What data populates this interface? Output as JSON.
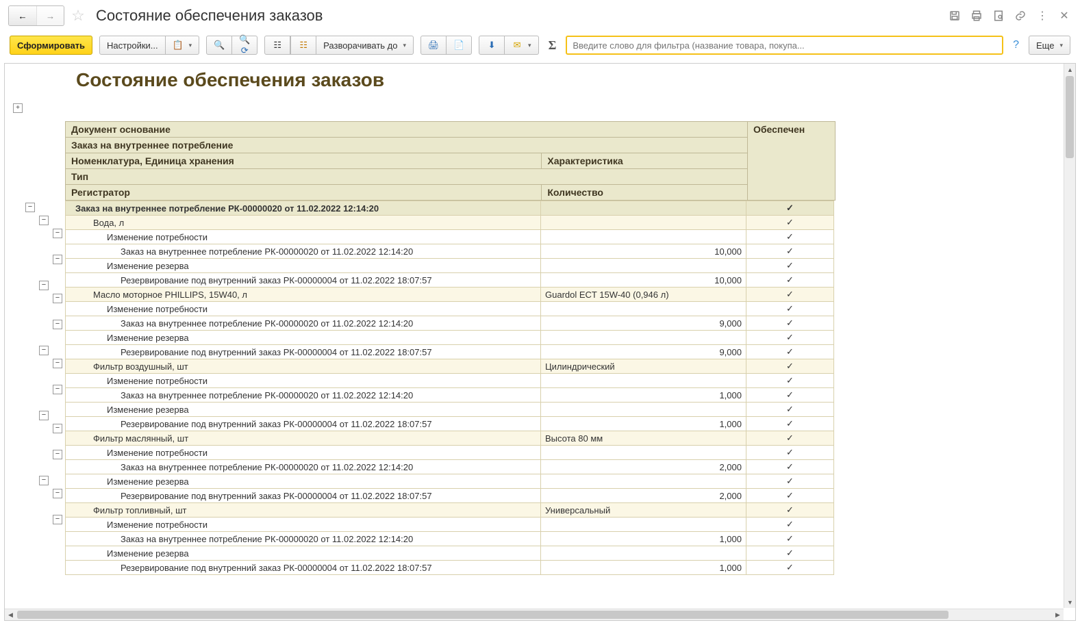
{
  "page_title": "Состояние обеспечения заказов",
  "report_title": "Состояние обеспечения заказов",
  "toolbar": {
    "generate": "Сформировать",
    "settings": "Настройки...",
    "expand_to": "Разворачивать до",
    "filter_placeholder": "Введите слово для фильтра (название товара, покупа...",
    "more": "Еще"
  },
  "headers": {
    "doc_basis": "Документ основание",
    "provided": "Обеспечен",
    "order_internal": "Заказ на внутреннее потребление",
    "nomenclature": "Номенклатура, Единица хранения",
    "characteristic": "Характеристика",
    "type": "Тип",
    "registrar": "Регистратор",
    "quantity": "Количество"
  },
  "rows": [
    {
      "lvl": 0,
      "text": "Заказ на внутреннее потребление РК-00000020 от 11.02.2022 12:14:20",
      "char": "",
      "prov": "✓"
    },
    {
      "lvl": 1,
      "text": "Вода, л",
      "char": "",
      "prov": "✓"
    },
    {
      "lvl": 2,
      "text": "Изменение потребности",
      "prov": "✓"
    },
    {
      "lvl": 3,
      "text": "Заказ на внутреннее потребление РК-00000020 от 11.02.2022 12:14:20",
      "qty": "10,000",
      "prov": "✓"
    },
    {
      "lvl": 2,
      "text": "Изменение резерва",
      "prov": "✓"
    },
    {
      "lvl": 3,
      "text": "Резервирование под внутренний заказ РК-00000004 от 11.02.2022 18:07:57",
      "qty": "10,000",
      "prov": "✓"
    },
    {
      "lvl": 1,
      "text": "Масло моторное PHILLIPS, 15W40, л",
      "char": "Guardol ECT 15W-40 (0,946 л)",
      "prov": "✓"
    },
    {
      "lvl": 2,
      "text": "Изменение потребности",
      "prov": "✓"
    },
    {
      "lvl": 3,
      "text": "Заказ на внутреннее потребление РК-00000020 от 11.02.2022 12:14:20",
      "qty": "9,000",
      "prov": "✓"
    },
    {
      "lvl": 2,
      "text": "Изменение резерва",
      "prov": "✓"
    },
    {
      "lvl": 3,
      "text": "Резервирование под внутренний заказ РК-00000004 от 11.02.2022 18:07:57",
      "qty": "9,000",
      "prov": "✓"
    },
    {
      "lvl": 1,
      "text": "Фильтр воздушный, шт",
      "char": "Цилиндрический",
      "prov": "✓"
    },
    {
      "lvl": 2,
      "text": "Изменение потребности",
      "prov": "✓"
    },
    {
      "lvl": 3,
      "text": "Заказ на внутреннее потребление РК-00000020 от 11.02.2022 12:14:20",
      "qty": "1,000",
      "prov": "✓"
    },
    {
      "lvl": 2,
      "text": "Изменение резерва",
      "prov": "✓"
    },
    {
      "lvl": 3,
      "text": "Резервирование под внутренний заказ РК-00000004 от 11.02.2022 18:07:57",
      "qty": "1,000",
      "prov": "✓"
    },
    {
      "lvl": 1,
      "text": "Фильтр маслянный, шт",
      "char": "Высота 80 мм",
      "prov": "✓"
    },
    {
      "lvl": 2,
      "text": "Изменение потребности",
      "prov": "✓"
    },
    {
      "lvl": 3,
      "text": "Заказ на внутреннее потребление РК-00000020 от 11.02.2022 12:14:20",
      "qty": "2,000",
      "prov": "✓"
    },
    {
      "lvl": 2,
      "text": "Изменение резерва",
      "prov": "✓"
    },
    {
      "lvl": 3,
      "text": "Резервирование под внутренний заказ РК-00000004 от 11.02.2022 18:07:57",
      "qty": "2,000",
      "prov": "✓"
    },
    {
      "lvl": 1,
      "text": "Фильтр топливный, шт",
      "char": "Универсальный",
      "prov": "✓"
    },
    {
      "lvl": 2,
      "text": "Изменение потребности",
      "prov": "✓"
    },
    {
      "lvl": 3,
      "text": "Заказ на внутреннее потребление РК-00000020 от 11.02.2022 12:14:20",
      "qty": "1,000",
      "prov": "✓"
    },
    {
      "lvl": 2,
      "text": "Изменение резерва",
      "prov": "✓"
    },
    {
      "lvl": 3,
      "text": "Резервирование под внутренний заказ РК-00000004 от 11.02.2022 18:07:57",
      "qty": "1,000",
      "prov": "✓"
    }
  ]
}
